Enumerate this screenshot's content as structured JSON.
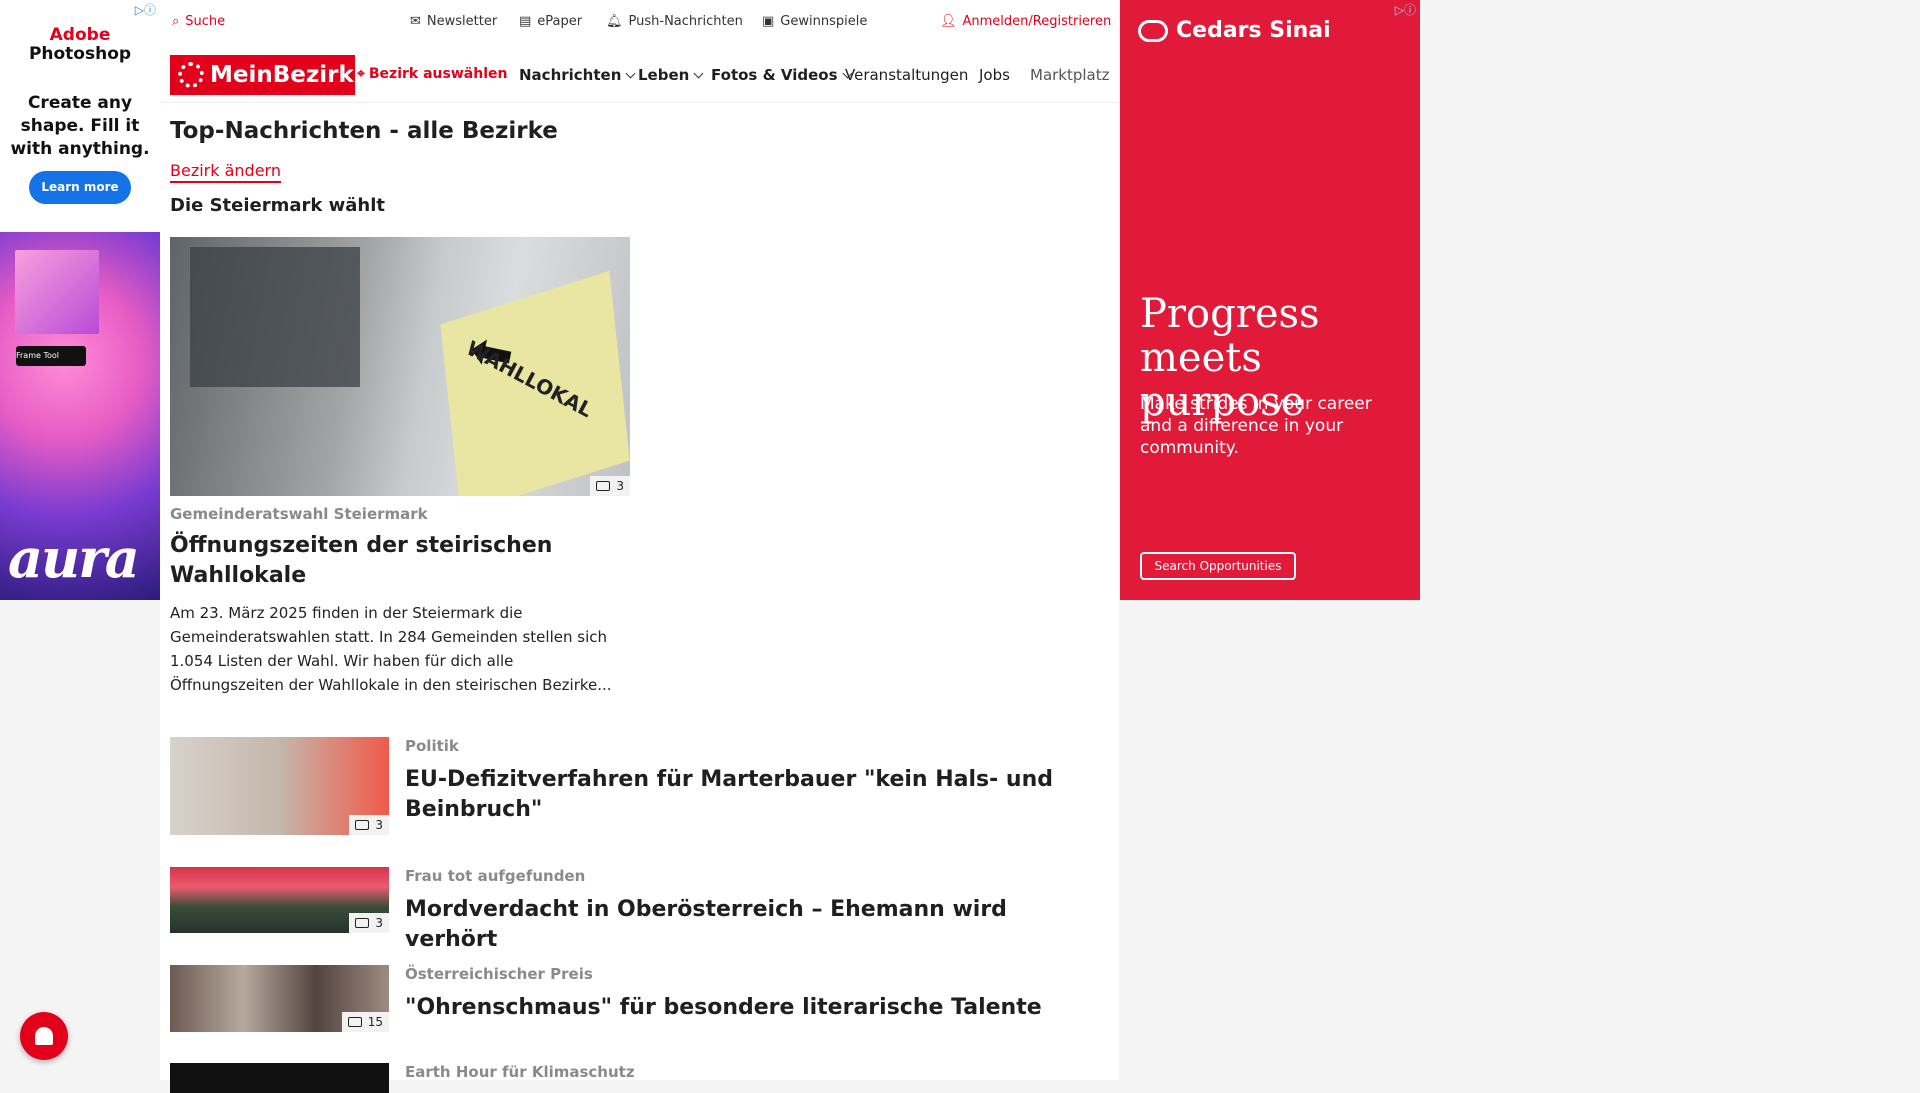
{
  "ad_left": {
    "brand_line1": "Adobe",
    "brand_line2": "Photoshop",
    "headline": "Create any shape. Fill it with anything.",
    "cta": "Learn more",
    "tool_label": "Frame Tool",
    "art_text": "aura"
  },
  "topbar": {
    "search": "Suche",
    "newsletter": "Newsletter",
    "epaper": "ePaper",
    "push": "Push-Nachrichten",
    "gewinnspiele": "Gewinnspiele",
    "login": "Anmelden/Registrieren"
  },
  "nav": {
    "logo": "MeinBezirk",
    "bezirk": "Bezirk auswählen",
    "items": [
      "Nachrichten",
      "Leben",
      "Fotos & Videos",
      "Veranstaltungen",
      "Jobs",
      "Marktplatz"
    ]
  },
  "page": {
    "title": "Top-Nachrichten - alle Bezirke",
    "bezirk_link": "Bezirk ändern",
    "section": "Die Steiermark wählt"
  },
  "lead": {
    "image_count": "3",
    "sign_text": "WAHLLOKAL",
    "kicker": "Gemeinderatswahl Steiermark",
    "title": "Öffnungszeiten der steirischen Wahllokale",
    "teaser": "Am 23. März 2025 finden in der Steiermark die Gemeinderatswahlen statt. In 284 Gemeinden stellen sich 1.054 Listen der Wahl. Wir haben für dich alle Öffnungszeiten der Wahllokale in den steirischen Bezirke..."
  },
  "articles": [
    {
      "kicker": "Politik",
      "title": "EU-Defizitverfahren für Marterbauer \"kein Hals- und Beinbruch\"",
      "count": "3"
    },
    {
      "kicker": "Frau tot aufgefunden",
      "title": "Mordverdacht in Oberösterreich – Ehemann wird verhört",
      "count": "3"
    },
    {
      "kicker": "Österreichischer Preis",
      "title": "\"Ohrenschmaus\" für besondere literarische Talente",
      "count": "15"
    },
    {
      "kicker": "Earth Hour für Klimaschutz",
      "title": "",
      "count": ""
    }
  ],
  "ad_right": {
    "brand": "Cedars Sinai",
    "headline": "Progress meets purpose",
    "sub": "Make strides in your career and a difference in your community.",
    "cta": "Search Opportunities"
  },
  "colors": {
    "brand_red": "#e3001b",
    "ad_red": "#e21a3a"
  }
}
